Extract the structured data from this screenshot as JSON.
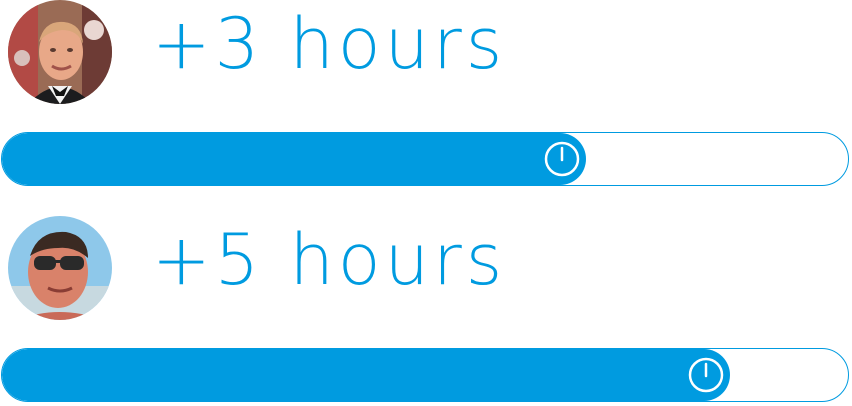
{
  "colors": {
    "accent": "#009be0",
    "track_background": "#ffffff",
    "knob_stroke": "#ffffff"
  },
  "entries": [
    {
      "label": "+3 hours",
      "progress": 0.69,
      "avatar": "avatar-photo-man-bowtie",
      "knob_icon": "clock-icon"
    },
    {
      "label": "+5 hours",
      "progress": 0.86,
      "avatar": "avatar-photo-man-sunglasses",
      "knob_icon": "clock-icon"
    }
  ]
}
